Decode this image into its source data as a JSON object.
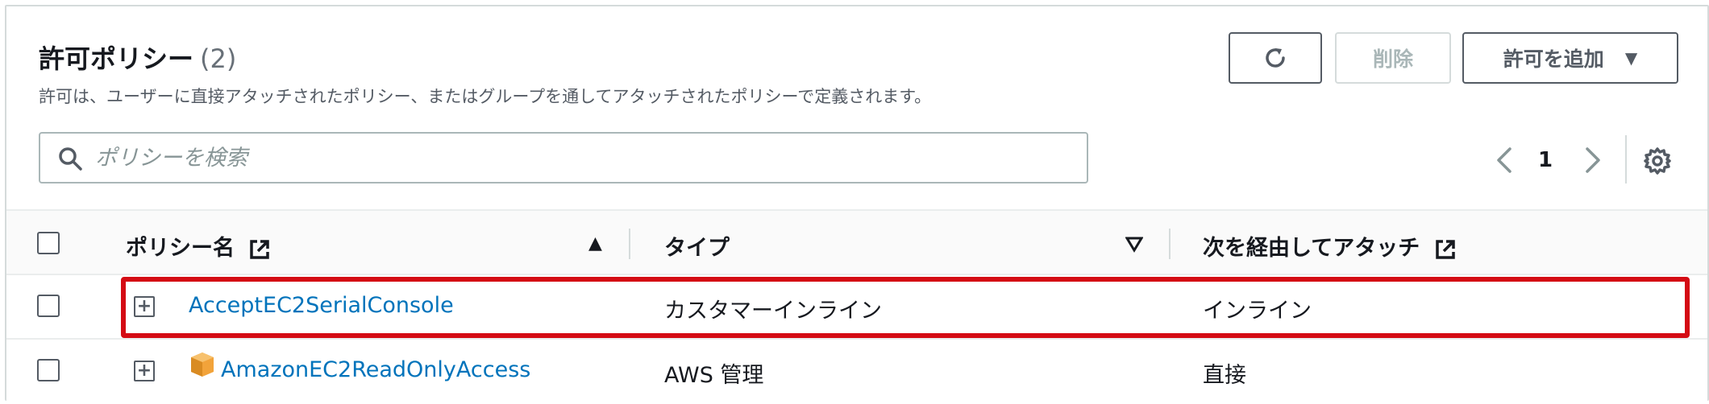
{
  "header": {
    "title": "許可ポリシー",
    "count": "(2)",
    "description": "許可は、ユーザーに直接アタッチされたポリシー、またはグループを通してアタッチされたポリシーで定義されます。"
  },
  "actions": {
    "refresh_icon": "refresh-icon",
    "delete_label": "削除",
    "add_label": "許可を追加"
  },
  "search": {
    "placeholder": "ポリシーを検索",
    "value": ""
  },
  "pagination": {
    "current_page": "1"
  },
  "table": {
    "columns": [
      {
        "label": "ポリシー名",
        "sort": "ascending"
      },
      {
        "label": "タイプ",
        "sort": "none"
      },
      {
        "label": "次を経由してアタッチ"
      }
    ],
    "rows": [
      {
        "name": "AcceptEC2SerialConsole",
        "type": "カスタマーインライン",
        "attached_via": "インライン",
        "highlighted": true
      },
      {
        "name": "AmazonEC2ReadOnlyAccess",
        "type": "AWS 管理",
        "attached_via": "直接",
        "icon": "aws-managed-policy-icon"
      }
    ]
  },
  "colors": {
    "link": "#0073bb",
    "highlight": "#d40b14",
    "aws_icon": "#f2a33a"
  }
}
